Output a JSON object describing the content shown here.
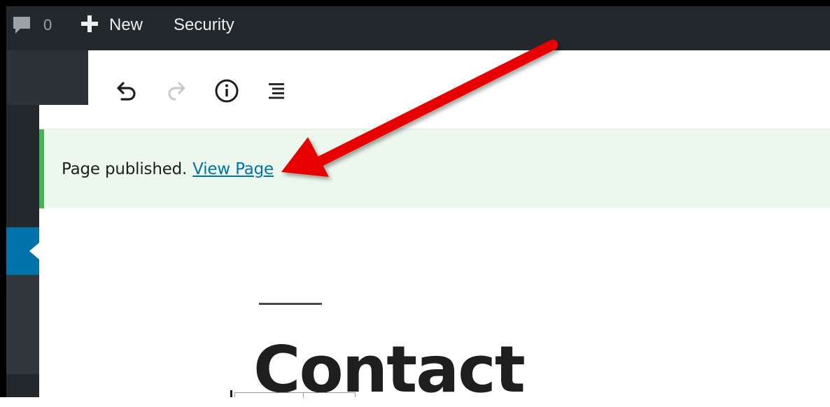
{
  "adminbar": {
    "comments_count": "0",
    "new_label": "New",
    "security_label": "Security"
  },
  "toolbar": {
    "buttons": [
      "undo-icon",
      "redo-icon",
      "info-icon",
      "list-view-icon"
    ]
  },
  "notice": {
    "text": "Page published.",
    "link_label": "View Page"
  },
  "content": {
    "title": "Contact"
  },
  "colors": {
    "adminbar_bg": "#23282d",
    "sidebar_active": "#0073aa",
    "notice_bg": "#ecf7ed",
    "notice_accent": "#46b450",
    "link": "#0073aa",
    "annotation_arrow": "#e60000"
  }
}
